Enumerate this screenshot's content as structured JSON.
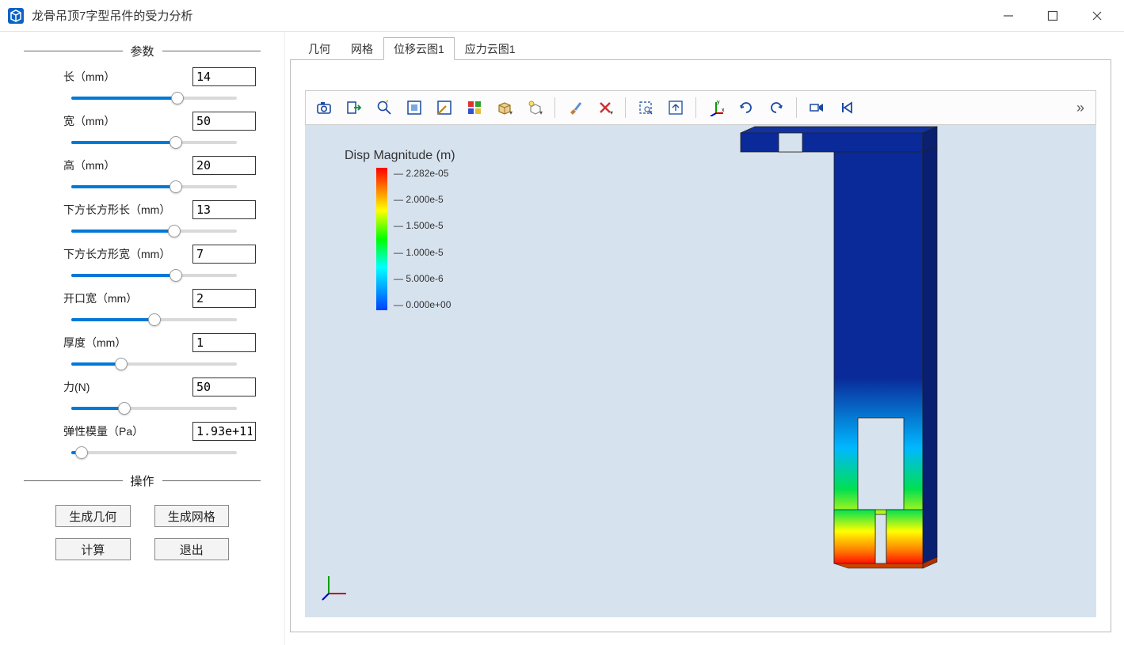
{
  "window": {
    "title": "龙骨吊顶7字型吊件的受力分析"
  },
  "sections": {
    "params": "参数",
    "ops": "操作"
  },
  "params": [
    {
      "label": "长（mm）",
      "value": "14",
      "pct": 64
    },
    {
      "label": "宽（mm）",
      "value": "50",
      "pct": 63
    },
    {
      "label": "高（mm）",
      "value": "20",
      "pct": 63
    },
    {
      "label": "下方长方形长（mm）",
      "value": "13",
      "pct": 62
    },
    {
      "label": "下方长方形宽（mm）",
      "value": "7",
      "pct": 63
    },
    {
      "label": "开口宽（mm）",
      "value": "2",
      "pct": 50
    },
    {
      "label": "厚度（mm）",
      "value": "1",
      "pct": 30
    },
    {
      "label": "力(N)",
      "value": "50",
      "pct": 32
    },
    {
      "label": "弹性模量（Pa）",
      "value": "1.93e+11",
      "pct": 6
    }
  ],
  "ops": {
    "gen_geom": "生成几何",
    "gen_mesh": "生成网格",
    "compute": "计算",
    "exit": "退出"
  },
  "tabs": [
    {
      "id": "geom",
      "label": "几何",
      "active": false
    },
    {
      "id": "mesh",
      "label": "网格",
      "active": false
    },
    {
      "id": "disp",
      "label": "位移云图1",
      "active": true
    },
    {
      "id": "stress",
      "label": "应力云图1",
      "active": false
    }
  ],
  "toolbar_icons": [
    "camera-icon",
    "export-icon",
    "zoom-icon",
    "window-fit-icon",
    "ruler-icon",
    "color-map-icon",
    "part-visibility-icon",
    "light-icon",
    "sep",
    "brush-icon",
    "delete-icon",
    "sep",
    "select-box-icon",
    "fit-view-icon",
    "sep",
    "axes-icon",
    "rotate-cw-icon",
    "rotate-ccw-icon",
    "sep",
    "animation-play-icon",
    "animation-first-icon"
  ],
  "legend": {
    "title": "Disp Magnitude (m)",
    "ticks": [
      "2.282e-05",
      "2.000e-5",
      "1.500e-5",
      "1.000e-5",
      "5.000e-6",
      "0.000e+00"
    ]
  },
  "chart_data": {
    "type": "heatmap",
    "field": "Displacement Magnitude",
    "unit": "m",
    "colormap": "rainbow (red=max, blue=min)",
    "range_min": 0.0,
    "range_max": 2.282e-05,
    "ticks": [
      2.282e-05,
      2e-05,
      1.5e-05,
      1e-05,
      5e-06,
      0.0
    ],
    "geometry_description": "7-shaped sheet-metal hanger: horizontal top flange, long vertical web, rectangular window and slot near bottom",
    "qualitative_distribution": {
      "top_flange": "≈0 (blue)",
      "upper_vertical": "≈0 (blue)",
      "mid_vertical": "≈5e-6 to 1e-5 (cyan→green)",
      "around_rectangular_cutout": "≈1e-5 to 1.5e-5 (green→yellow)",
      "bottom_legs": "≈2e-5 to 2.28e-5 (orange→red, maximum)"
    }
  }
}
